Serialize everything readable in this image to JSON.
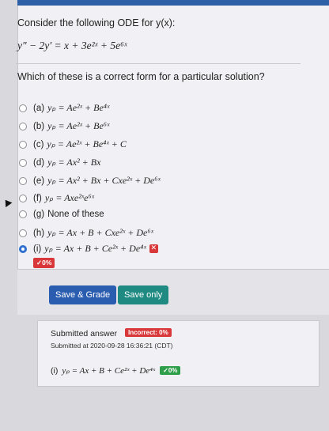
{
  "question": {
    "intro": "Consider the following ODE for y(x):",
    "ode": "y″ − 2y′ = x + 3e²ˣ + 5e⁶ˣ",
    "prompt": "Which of these is a correct form for a particular solution?"
  },
  "options": [
    {
      "label": "(a)",
      "expr": "yₚ = Ae²ˣ + Be⁴ˣ",
      "selected": false
    },
    {
      "label": "(b)",
      "expr": "yₚ = Ae²ˣ + Be⁶ˣ",
      "selected": false
    },
    {
      "label": "(c)",
      "expr": "yₚ = Ae²ˣ + Be⁴ˣ + C",
      "selected": false
    },
    {
      "label": "(d)",
      "expr": "yₚ = Ax² + Bx",
      "selected": false
    },
    {
      "label": "(e)",
      "expr": "yₚ = Ax² + Bx + Cxe²ˣ + De⁶ˣ",
      "selected": false
    },
    {
      "label": "(f)",
      "expr": "yₚ = Axe²ˣe⁶ˣ",
      "selected": false
    },
    {
      "label": "(g)",
      "expr": "None of these",
      "selected": false
    },
    {
      "label": "(h)",
      "expr": "yₚ = Ax + B + Cxe²ˣ + De⁶ˣ",
      "selected": false
    },
    {
      "label": "(i)",
      "expr": "yₚ = Ax + B + Ce²ˣ + De⁴ˣ",
      "selected": true
    }
  ],
  "result_percent": "✓0%",
  "buttons": {
    "save_grade": "Save & Grade",
    "save_only": "Save only"
  },
  "submission": {
    "title": "Submitted answer",
    "status_badge": "Incorrect: 0%",
    "timestamp": "Submitted at 2020-09-28 16:36:21 (CDT)",
    "answer_label": "(i)",
    "answer_expr": "yₚ = Ax + B + Ce²ˣ + De⁴ˣ",
    "score_badge": "✓0%"
  },
  "icons": {
    "wrong": "x-mark-icon",
    "cursor": "mouse-cursor-icon"
  },
  "colors": {
    "primary": "#2a5db0",
    "teal": "#1f8a82",
    "error": "#d9383a",
    "success": "#2f9e4a"
  }
}
